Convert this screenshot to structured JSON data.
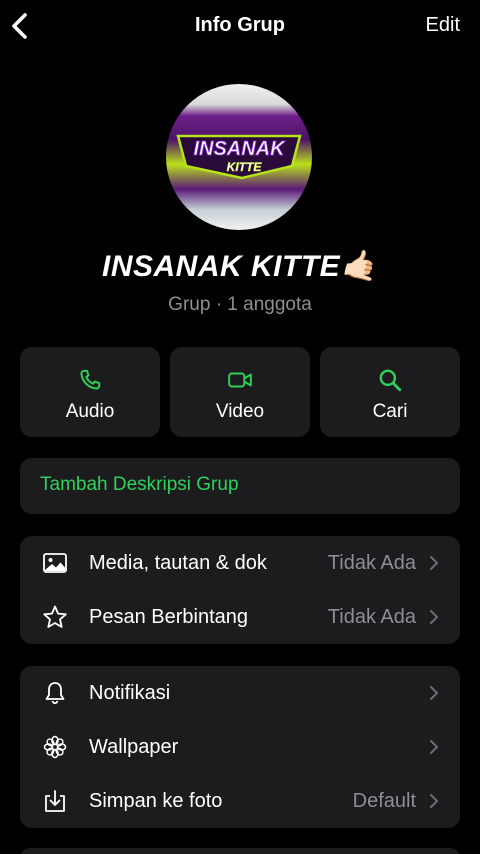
{
  "header": {
    "title": "Info Grup",
    "edit_label": "Edit"
  },
  "group": {
    "logo_text_top": "INSANAK",
    "logo_text_bottom": "KITTE",
    "name": "INSANAK KITTE🤙🏻",
    "subtitle": "Grup · 1 anggota"
  },
  "actions": [
    {
      "label": "Audio",
      "icon": "phone-icon"
    },
    {
      "label": "Video",
      "icon": "video-icon"
    },
    {
      "label": "Cari",
      "icon": "search-icon"
    }
  ],
  "description": {
    "label": "Tambah Deskripsi Grup"
  },
  "list1": [
    {
      "label": "Media, tautan & dok",
      "value": "Tidak Ada",
      "icon": "image-icon"
    },
    {
      "label": "Pesan Berbintang",
      "value": "Tidak Ada",
      "icon": "star-icon"
    }
  ],
  "list2": [
    {
      "label": "Notifikasi",
      "value": "",
      "icon": "bell-icon"
    },
    {
      "label": "Wallpaper",
      "value": "",
      "icon": "flower-icon"
    },
    {
      "label": "Simpan ke foto",
      "value": "Default",
      "icon": "download-icon"
    }
  ],
  "colors": {
    "accent": "#2fd159",
    "card": "#1c1c1e",
    "secondary_text": "#8e8e93",
    "background": "#000000"
  }
}
